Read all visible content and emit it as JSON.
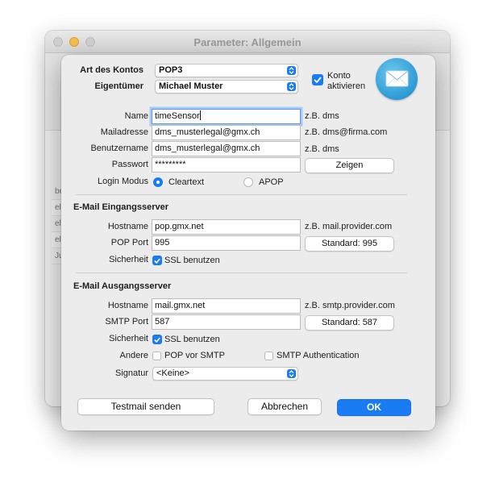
{
  "parent": {
    "title": "Parameter: Allgemein",
    "list_items": [
      "be",
      "ell",
      "ell",
      "ell",
      "Ju"
    ]
  },
  "account": {
    "type_label": "Art des Kontos",
    "type_value": "POP3",
    "owner_label": "Eigentümer",
    "owner_value": "Michael Muster",
    "activate_label_line1": "Konto",
    "activate_label_line2": "aktivieren",
    "activate_checked": true,
    "icon": "mail-envelope-icon"
  },
  "identity": {
    "name_label": "Name",
    "name_value": "timeSensor",
    "name_hint": "z.B. dms",
    "mail_label": "Mailadresse",
    "mail_value": "dms_musterlegal@gmx.ch",
    "mail_hint": "z.B. dms@firma.com",
    "user_label": "Benutzername",
    "user_value": "dms_musterlegal@gmx.ch",
    "user_hint": "z.B. dms",
    "password_label": "Passwort",
    "password_value": "*********",
    "show_button": "Zeigen",
    "login_label": "Login Modus",
    "login_option_1": "Cleartext",
    "login_option_2": "APOP",
    "login_selected": "Cleartext"
  },
  "incoming": {
    "title": "E-Mail Eingangsserver",
    "host_label": "Hostname",
    "host_value": "pop.gmx.net",
    "host_hint": "z.B. mail.provider.com",
    "port_label": "POP Port",
    "port_value": "995",
    "port_button": "Standard: 995",
    "security_label": "Sicherheit",
    "ssl_label": "SSL benutzen",
    "ssl_checked": true
  },
  "outgoing": {
    "title": "E-Mail Ausgangsserver",
    "host_label": "Hostname",
    "host_value": "mail.gmx.net",
    "host_hint": "z.B. smtp.provider.com",
    "port_label": "SMTP Port",
    "port_value": "587",
    "port_button": "Standard: 587",
    "security_label": "Sicherheit",
    "ssl_label": "SSL benutzen",
    "ssl_checked": true,
    "other_label": "Andere",
    "pop_before_smtp_label": "POP vor SMTP",
    "pop_before_smtp_checked": false,
    "smtp_auth_label": "SMTP Authentication",
    "smtp_auth_checked": false,
    "signature_label": "Signatur",
    "signature_value": "<Keine>"
  },
  "footer": {
    "testmail_button": "Testmail senden",
    "cancel_button": "Abbrechen",
    "ok_button": "OK"
  },
  "colors": {
    "accent": "#1a7cf5",
    "focus_ring": "#a8cbf5",
    "window_bg": "#ececec"
  }
}
